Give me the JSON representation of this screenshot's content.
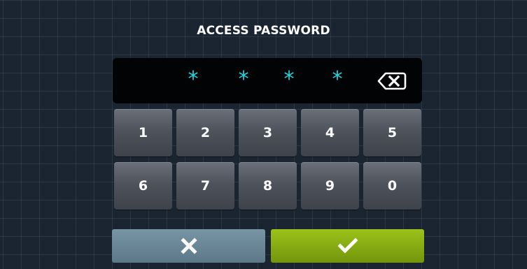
{
  "title": "ACCESS PASSWORD",
  "display": {
    "mask_chars": [
      "*",
      "*",
      "*",
      "*"
    ]
  },
  "keypad": {
    "keys": [
      "1",
      "2",
      "3",
      "4",
      "5",
      "6",
      "7",
      "8",
      "9",
      "0"
    ]
  },
  "icons": {
    "backspace": "backspace-icon",
    "cancel": "x-icon",
    "confirm": "check-icon"
  },
  "colors": {
    "mask": "#1ad7e0",
    "cancel_button": "#6a889a",
    "confirm_button": "#8ab014",
    "key": "#4e535c"
  }
}
